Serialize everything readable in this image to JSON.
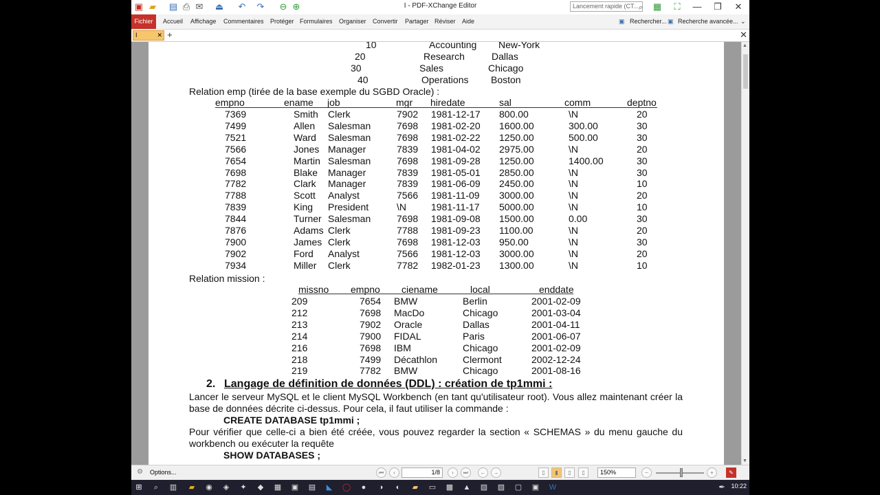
{
  "window": {
    "title": "I - PDF-XChange Editor",
    "quick_search_placeholder": "Lancement rapide (CT...",
    "minimize": "—",
    "restore": "❐",
    "close": "✕"
  },
  "ribbon": {
    "file_tab": "Fichier",
    "tabs": [
      "Accueil",
      "Affichage",
      "Commentaires",
      "Protéger",
      "Formulaires",
      "Organiser",
      "Convertir",
      "Partager",
      "Réviser",
      "Aide"
    ],
    "search_label": "Rechercher...",
    "advanced_search_label": "Recherche avancée..."
  },
  "doc_tab": {
    "label": "I",
    "close": "✕",
    "new": "+"
  },
  "document": {
    "dept_rows": [
      [
        "10",
        "Accounting",
        "New-York"
      ],
      [
        "20",
        "Research",
        "Dallas"
      ],
      [
        "30",
        "Sales",
        "Chicago"
      ],
      [
        "40",
        "Operations",
        "Boston"
      ]
    ],
    "emp_caption": "Relation emp (tirée de la base exemple du SGBD Oracle) :",
    "emp_headers": [
      "empno",
      "ename",
      "job",
      "mgr",
      "hiredate",
      "sal",
      "comm",
      "deptno"
    ],
    "emp_rows": [
      [
        "7369",
        "Smith",
        "Clerk",
        "7902",
        "1981-12-17",
        "800.00",
        "\\N",
        "20"
      ],
      [
        "7499",
        "Allen",
        "Salesman",
        "7698",
        "1981-02-20",
        "1600.00",
        "300.00",
        "30"
      ],
      [
        "7521",
        "Ward",
        "Salesman",
        "7698",
        "1981-02-22",
        "1250.00",
        "500.00",
        "30"
      ],
      [
        "7566",
        "Jones",
        "Manager",
        "7839",
        "1981-04-02",
        "2975.00",
        "\\N",
        "20"
      ],
      [
        "7654",
        "Martin",
        "Salesman",
        "7698",
        "1981-09-28",
        "1250.00",
        "1400.00",
        "30"
      ],
      [
        "7698",
        "Blake",
        "Manager",
        "7839",
        "1981-05-01",
        "2850.00",
        "\\N",
        "30"
      ],
      [
        "7782",
        "Clark",
        "Manager",
        "7839",
        "1981-06-09",
        "2450.00",
        "\\N",
        "10"
      ],
      [
        "7788",
        "Scott",
        "Analyst",
        "7566",
        "1981-11-09",
        "3000.00",
        "\\N",
        "20"
      ],
      [
        "7839",
        "King",
        "President",
        "\\N",
        "1981-11-17",
        "5000.00",
        "\\N",
        "10"
      ],
      [
        "7844",
        "Turner",
        "Salesman",
        "7698",
        "1981-09-08",
        "1500.00",
        "0.00",
        "30"
      ],
      [
        "7876",
        "Adams",
        "Clerk",
        "7788",
        "1981-09-23",
        "1100.00",
        "\\N",
        "20"
      ],
      [
        "7900",
        "James",
        "Clerk",
        "7698",
        "1981-12-03",
        "950.00",
        "\\N",
        "30"
      ],
      [
        "7902",
        "Ford",
        "Analyst",
        "7566",
        "1981-12-03",
        "3000.00",
        "\\N",
        "20"
      ],
      [
        "7934",
        "Miller",
        "Clerk",
        "7782",
        "1982-01-23",
        "1300.00",
        "\\N",
        "10"
      ]
    ],
    "mission_caption": "Relation mission :",
    "mission_headers": [
      "missno",
      "empno",
      "ciename",
      "local",
      "enddate"
    ],
    "mission_rows": [
      [
        "209",
        "7654",
        "BMW",
        "Berlin",
        "2001-02-09"
      ],
      [
        "212",
        "7698",
        "MacDo",
        "Chicago",
        "2001-03-04"
      ],
      [
        "213",
        "7902",
        "Oracle",
        "Dallas",
        "2001-04-11"
      ],
      [
        "214",
        "7900",
        "FIDAL",
        "Paris",
        "2001-06-07"
      ],
      [
        "216",
        "7698",
        "IBM",
        "Chicago",
        "2001-02-09"
      ],
      [
        "218",
        "7499",
        "Décathlon",
        "Clermont",
        "2002-12-24"
      ],
      [
        "219",
        "7782",
        "BMW",
        "Chicago",
        "2001-08-16"
      ]
    ],
    "section_number": "2.",
    "section_title": "Langage de définition de données (DDL) : création de tp1mmi :",
    "para1": "Lancer le serveur MySQL et le client MySQL Workbench (en tant qu'utilisateur root). Vous allez maintenant créer la base de données décrite ci-dessus. Pour cela, il faut utiliser la commande :",
    "code1": "CREATE DATABASE tp1mmi ;",
    "para2": "Pour vérifier que celle-ci a bien été créée, vous pouvez regarder la section « SCHEMAS » du menu gauche du workbench ou exécuter la requête",
    "code2": "SHOW DATABASES ;"
  },
  "statusbar": {
    "options_label": "Options...",
    "page_value": "1/8",
    "zoom_value": "150%"
  },
  "taskbar": {
    "clock": "10:22"
  }
}
